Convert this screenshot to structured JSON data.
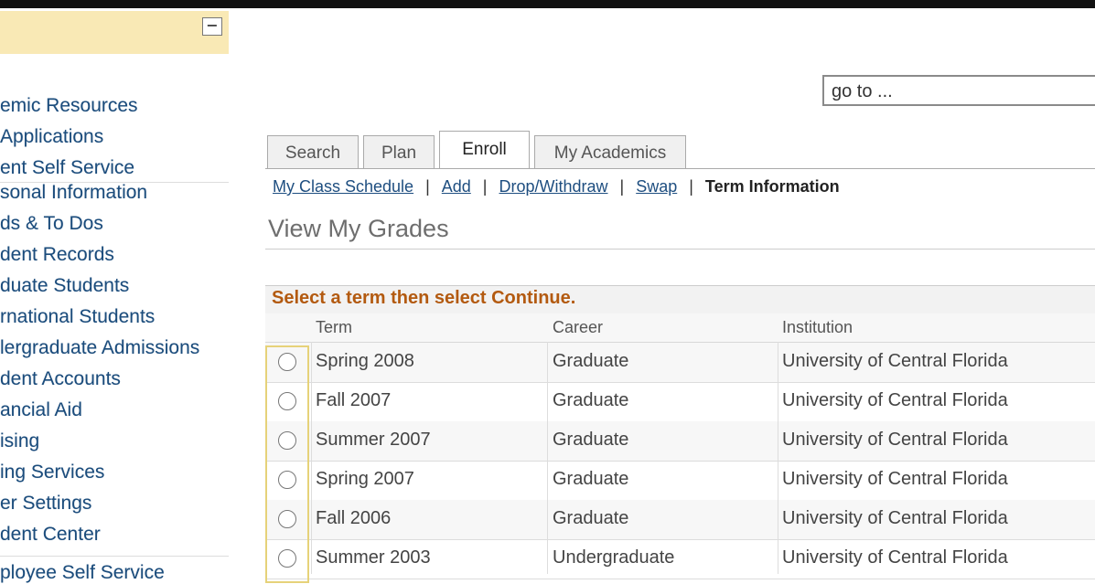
{
  "menu": {
    "collapse_label": "−",
    "items": [
      "emic Resources",
      "Applications",
      "ent Self Service",
      "sonal Information",
      "ds & To Dos",
      "dent Records",
      "duate Students",
      "rnational Students",
      "lergraduate Admissions",
      "dent Accounts",
      "ancial Aid",
      "ising",
      "ing Services",
      "er Settings",
      "dent Center",
      "ployee Self Service"
    ]
  },
  "search": {
    "value": "go to ..."
  },
  "tabs": [
    {
      "label": "Search",
      "active": false
    },
    {
      "label": "Plan",
      "active": false
    },
    {
      "label": "Enroll",
      "active": true
    },
    {
      "label": "My Academics",
      "active": false
    }
  ],
  "subnav": {
    "links": [
      "My Class Schedule",
      "Add",
      "Drop/Withdraw",
      "Swap"
    ],
    "separator": "|",
    "current": "Term Information"
  },
  "page_title": "View My Grades",
  "grid": {
    "title": "Select a term then select Continue.",
    "columns": [
      "Term",
      "Career",
      "Institution"
    ],
    "rows": [
      {
        "term": "Spring 2008",
        "career": "Graduate",
        "institution": "University of Central Florida"
      },
      {
        "term": "Fall 2007",
        "career": "Graduate",
        "institution": "University of Central Florida"
      },
      {
        "term": "Summer 2007",
        "career": "Graduate",
        "institution": "University of Central Florida"
      },
      {
        "term": "Spring 2007",
        "career": "Graduate",
        "institution": "University of Central Florida"
      },
      {
        "term": "Fall 2006",
        "career": "Graduate",
        "institution": "University of Central Florida"
      },
      {
        "term": "Summer 2003",
        "career": "Undergraduate",
        "institution": "University of Central Florida"
      }
    ]
  },
  "colors": {
    "accent_orange": "#b35a10",
    "link_blue": "#1e4e80",
    "menu_header": "#f9e9b5"
  }
}
